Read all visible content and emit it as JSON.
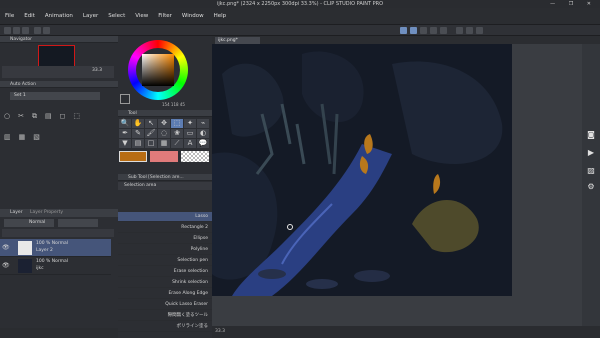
{
  "window": {
    "title": "ijkc.png* (2324 x 2250px 300dpi 33.3%)  - CLIP STUDIO PAINT PRO",
    "controls": "— ❐ ✕"
  },
  "menu": [
    "File",
    "Edit",
    "Animation",
    "Layer",
    "Select",
    "View",
    "Filter",
    "Window",
    "Help"
  ],
  "navigator": {
    "title": "Navigator",
    "zoom": "33.3"
  },
  "auto_action": {
    "title": "Auto Action",
    "set": "Set 1"
  },
  "color_wheel": {
    "values": "154  118  45",
    "main_color": "#b86d14"
  },
  "tool_palette": {
    "title": "Tool"
  },
  "sub_tool": {
    "title": "Sub Tool [Selection are...",
    "tab": "Selection area",
    "items": [
      "Lasso",
      "Rectangle 2",
      "Ellipse",
      "Polyline",
      "Selection pen",
      "Erase selection",
      "Shrink selection",
      "Erase Along Edge",
      "Quick Lasso Eraser",
      "隙間無く塗るツール",
      "ポリライン塗る"
    ],
    "footer": "0 1"
  },
  "swatches": {
    "colors": [
      "#b86d14",
      "#e07b7b",
      "checker"
    ]
  },
  "layers": {
    "tabs": [
      "Layer",
      "Layer Property"
    ],
    "blend_mode": "Normal",
    "opacity": "100",
    "rows": [
      {
        "percent": "100 % Normal",
        "name": "Layer 2"
      },
      {
        "percent": "100 % Normal",
        "name": "ijkc"
      }
    ]
  },
  "document": {
    "tab": "ijkc.png*"
  },
  "status_bar": {
    "zoom": "33.3"
  },
  "right_toolbar": {
    "icons": [
      "camera-icon",
      "video-icon",
      "gallery-icon",
      "settings-icon"
    ]
  }
}
